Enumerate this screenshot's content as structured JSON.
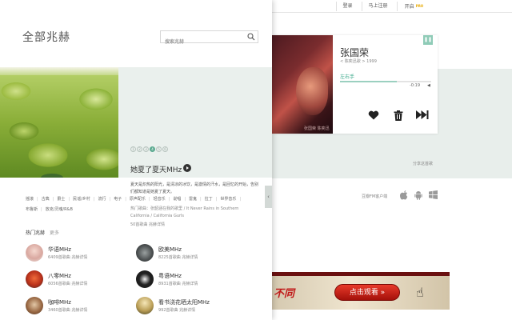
{
  "top_nav": {
    "login": "登录",
    "register": "马上注册",
    "open": "开启",
    "pro": "PRO"
  },
  "panel": {
    "title": "全部兆赫",
    "search_placeholder": "搜索兆赫"
  },
  "feature": {
    "pages": [
      "1",
      "2",
      "3",
      "4",
      "5",
      "6"
    ],
    "active_page": "4",
    "title": "她夏了夏天MHz",
    "description": "夏天是炽热的阳光，是清凉的冰饮，是激情的汗水，是回忆的开始，告别们都知道是她夏了夏天。",
    "hot_songs": "热门歌曲：张韶涵在我的歌里 / It Never Rains in Southern California / California Gurls",
    "links": "50首歌曲  兆赫详情"
  },
  "tags": [
    "摇滚",
    "古典",
    "爵士",
    "民谣/乡村",
    "流行",
    "电子",
    "原声配乐",
    "轻音乐",
    "说唱",
    "雷鬼",
    "拉丁",
    "世界音乐",
    "布鲁斯",
    "放克/灵魂/R&B"
  ],
  "hot_stations": {
    "heading": "热门兆赫",
    "more": "更多",
    "items": [
      {
        "name": "华语MHz",
        "meta": "6409首歌曲  兆赫详情"
      },
      {
        "name": "欧美MHz",
        "meta": "8225首歌曲  兆赫详情"
      },
      {
        "name": "八零MHz",
        "meta": "6056首歌曲  兆赫详情"
      },
      {
        "name": "粤语MHz",
        "meta": "8931首歌曲  兆赫详情"
      },
      {
        "name": "咖啡MHz",
        "meta": "3460首歌曲  兆赫详情"
      },
      {
        "name": "看书浇花晒太阳MHz",
        "meta": "992首歌曲  兆赫详情"
      }
    ]
  },
  "player": {
    "singer": "张国荣",
    "album_meta": "< 陈奕迅歌 > 1999",
    "song": "左右手",
    "time": "-0:19",
    "progress": 0.62,
    "album_caption": "张国荣 陈奕迅"
  },
  "share_link": "分享这首歌",
  "os_text": "豆瓣FM客户端",
  "ad": {
    "text": "不同",
    "button": "点击观看 »"
  },
  "colors": {
    "accent": "#5aa98f",
    "band": "#e8eeeb"
  }
}
